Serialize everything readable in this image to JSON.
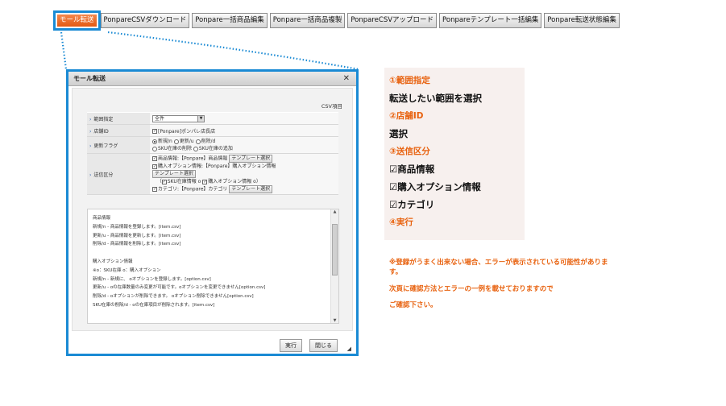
{
  "toolbar": {
    "tabs": [
      {
        "label": "モール転送",
        "active": true
      },
      {
        "label": "PonpareCSVダウンロード",
        "active": false
      },
      {
        "label": "Ponpare一括商品編集",
        "active": false
      },
      {
        "label": "Ponpare一括商品複製",
        "active": false
      },
      {
        "label": "PonpareCSVアップロード",
        "active": false
      },
      {
        "label": "Ponpareテンプレート一括編集",
        "active": false
      },
      {
        "label": "Ponpare転送状態編集",
        "active": false
      }
    ],
    "active_color": "#e8620f",
    "highlight_color": "#1a8ad4"
  },
  "dialog": {
    "title": "モール転送",
    "close_icon": "close-icon",
    "csv_label": "CSV項目",
    "rows": {
      "range": {
        "label": "範囲指定",
        "value": "全件"
      },
      "shop": {
        "label": "店舗ID",
        "value": "[Ponpare]ポンパレ店長店"
      },
      "update": {
        "label": "更新フラグ",
        "line1": [
          "新規/n",
          "更新/u",
          "削除/d"
        ],
        "line2": [
          "SKU在庫の削除",
          "SKU在庫の追加"
        ]
      },
      "send": {
        "label": "送信区分",
        "product": "商品情報:【Ponpare】商品情報",
        "option": "購入オプション情報:【Ponpare】購入オプション情報",
        "sku_open": "（",
        "sku_del": "SKU在庫情報 o",
        "sku_opt": "購入オプション情報 o",
        "sku_close": "）",
        "category": "カテゴリ:【Ponpare】カテゴリ",
        "template_button": "テンプレート選択"
      }
    },
    "help_lines": [
      "商品情報",
      "新規/n - 商品情報を登録します。[item.csv]",
      "更新/u - 商品情報を更新します。[item.csv]",
      "削除/d - 商品情報を削除します。[item.csv]",
      "",
      "購入オプション情報",
      "※o：SKU在庫 o：購入オプション",
      "新規/n - 新規に、 oオプションを登録します。[option.csv]",
      "更新/u - oの在庫数量のみ変更が可能です。oオプションを変更できません[option.csv]",
      "削除/d - oオプションが削除できます。 oオプション削除できません[option.csv]",
      "SKU在庫の削除/d - oの在庫項目が削除されます。[item.csv]"
    ],
    "buttons": {
      "execute": "実行",
      "close": "閉じる"
    }
  },
  "annotations": [
    {
      "kind": "head",
      "text": "①範囲指定"
    },
    {
      "kind": "body",
      "text": "転送したい範囲を選択"
    },
    {
      "kind": "head",
      "text": "②店舗ID"
    },
    {
      "kind": "body",
      "text": "選択"
    },
    {
      "kind": "head",
      "text": "③送信区分"
    },
    {
      "kind": "body",
      "text": "☑商品情報"
    },
    {
      "kind": "body",
      "text": "☑購入オプション情報"
    },
    {
      "kind": "body",
      "text": "☑カテゴリ"
    },
    {
      "kind": "head",
      "text": "④実行"
    }
  ],
  "notes": [
    "※登録がうまく出来ない場合、エラーが表示されている可能性がありま",
    "す。",
    "次頁に確認方法とエラーの一例を載せておりますので",
    "ご確認下さい。"
  ]
}
